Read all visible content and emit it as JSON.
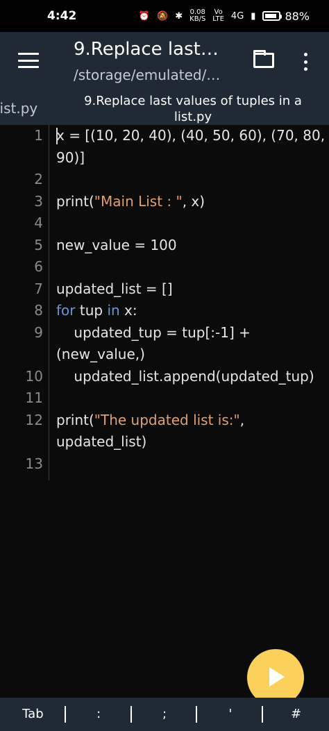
{
  "status_bar": {
    "time": "4:42",
    "net_rate_value": "0.08",
    "net_rate_unit": "KB/S",
    "volte_top": "Vo",
    "volte_bottom": "LTE",
    "network": "4G",
    "battery_percent": "88%",
    "battery_level": 0.88
  },
  "app_bar": {
    "title": "9.Replace last…",
    "subtitle": "/storage/emulated/…"
  },
  "tabs": {
    "inactive_label": "list.py",
    "active_label": "9.Replace last values of tuples in a list.py"
  },
  "editor": {
    "lines": [
      {
        "num": "1",
        "segments": [
          {
            "t": "x = [(10, 20, 40), (40, 50, 60), (70, 80,",
            "c": "plain"
          }
        ]
      },
      {
        "num": "",
        "segments": [
          {
            "t": "90)]",
            "c": "plain"
          }
        ]
      },
      {
        "num": "2",
        "segments": []
      },
      {
        "num": "3",
        "segments": [
          {
            "t": "print(",
            "c": "plain"
          },
          {
            "t": "\"Main List : \"",
            "c": "str"
          },
          {
            "t": ", x)",
            "c": "plain"
          }
        ]
      },
      {
        "num": "4",
        "segments": []
      },
      {
        "num": "5",
        "segments": [
          {
            "t": "new_value = 100",
            "c": "plain"
          }
        ]
      },
      {
        "num": "6",
        "segments": []
      },
      {
        "num": "7",
        "segments": [
          {
            "t": "updated_list = []",
            "c": "plain"
          }
        ]
      },
      {
        "num": "8",
        "segments": [
          {
            "t": "for",
            "c": "kw"
          },
          {
            "t": " tup ",
            "c": "plain"
          },
          {
            "t": "in",
            "c": "kw"
          },
          {
            "t": " x:",
            "c": "plain"
          }
        ]
      },
      {
        "num": "9",
        "segments": [
          {
            "t": "    updated_tup = tup[:-1] +",
            "c": "plain"
          }
        ]
      },
      {
        "num": "",
        "segments": [
          {
            "t": "(new_value,)",
            "c": "plain"
          }
        ]
      },
      {
        "num": "10",
        "segments": [
          {
            "t": "    updated_list.append(updated_tup)",
            "c": "plain"
          }
        ]
      },
      {
        "num": "11",
        "segments": []
      },
      {
        "num": "12",
        "segments": [
          {
            "t": "print(",
            "c": "plain"
          },
          {
            "t": "\"The updated list is:\"",
            "c": "str"
          },
          {
            "t": ",",
            "c": "plain"
          }
        ]
      },
      {
        "num": "",
        "segments": [
          {
            "t": "updated_list)",
            "c": "plain"
          }
        ]
      },
      {
        "num": "13",
        "segments": []
      }
    ]
  },
  "keybar": {
    "keys": [
      "Tab",
      ":",
      ";",
      "'",
      "#"
    ]
  },
  "icons": {
    "menu": "hamburger-icon",
    "folder": "folder-icon",
    "more": "more-vert-icon",
    "run": "play-icon"
  },
  "colors": {
    "app_bar": "#1f2a35",
    "editor_bg": "#0b0b0b",
    "string": "#e3a06f",
    "keyword": "#6b96d6",
    "run_button": "#fbd15c"
  }
}
